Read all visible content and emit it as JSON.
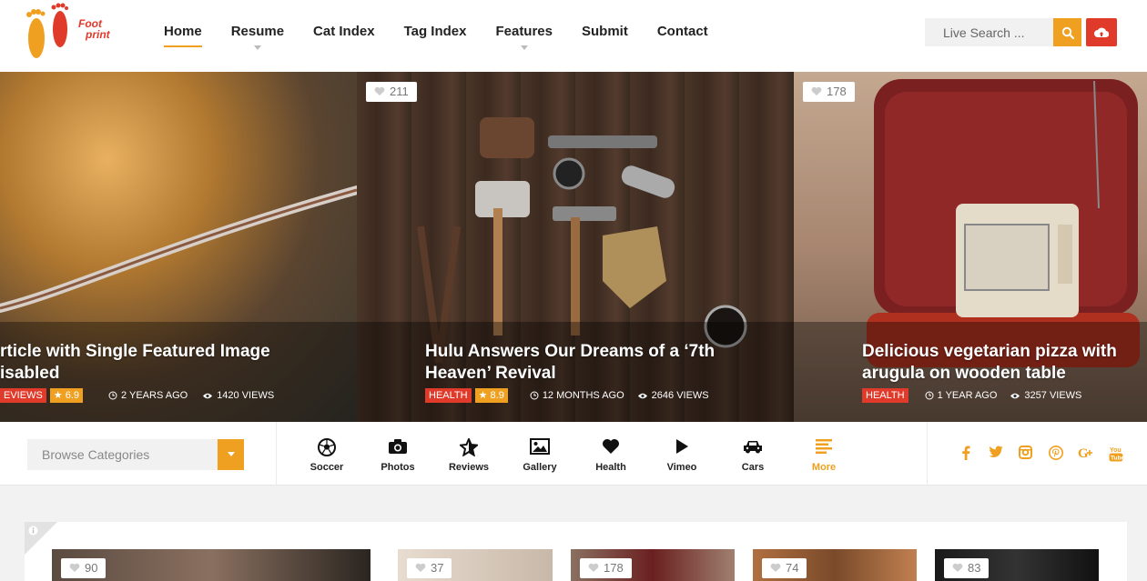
{
  "logo": {
    "text_line1": "Foot",
    "text_line2": "print"
  },
  "nav": {
    "items": [
      {
        "label": "Home",
        "active": true,
        "has_dropdown": false
      },
      {
        "label": "Resume",
        "active": false,
        "has_dropdown": true
      },
      {
        "label": "Cat Index",
        "active": false,
        "has_dropdown": false
      },
      {
        "label": "Tag Index",
        "active": false,
        "has_dropdown": false
      },
      {
        "label": "Features",
        "active": false,
        "has_dropdown": true
      },
      {
        "label": "Submit",
        "active": false,
        "has_dropdown": false
      },
      {
        "label": "Contact",
        "active": false,
        "has_dropdown": false
      }
    ]
  },
  "search": {
    "placeholder": "Live Search ..."
  },
  "slides": [
    {
      "title_line1": "rticle with Single Featured Image",
      "title_line2": "isabled",
      "category": "EVIEWS",
      "rating": "6.9",
      "age": "2 YEARS AGO",
      "views": "1420 VIEWS",
      "likes": ""
    },
    {
      "title_line1": "Hulu Answers Our Dreams of a ‘7th",
      "title_line2": "Heaven’ Revival",
      "category": "HEALTH",
      "rating": "8.9",
      "age": "12 MONTHS AGO",
      "views": "2646 VIEWS",
      "likes": "211"
    },
    {
      "title_line1": "Delicious vegetarian pizza with",
      "title_line2": "arugula on wooden table",
      "category": "HEALTH",
      "rating": "",
      "age": "1 YEAR AGO",
      "views": "3257 VIEWS",
      "likes": "178"
    }
  ],
  "categories": {
    "browse_label": "Browse Categories",
    "items": [
      {
        "label": "Soccer",
        "icon": "soccer-ball-icon"
      },
      {
        "label": "Photos",
        "icon": "camera-icon"
      },
      {
        "label": "Reviews",
        "icon": "star-icon"
      },
      {
        "label": "Gallery",
        "icon": "image-icon"
      },
      {
        "label": "Health",
        "icon": "heart-icon"
      },
      {
        "label": "Vimeo",
        "icon": "play-icon"
      },
      {
        "label": "Cars",
        "icon": "car-icon"
      },
      {
        "label": "More",
        "icon": "menu-lines-icon"
      }
    ]
  },
  "social": [
    "facebook-icon",
    "twitter-icon",
    "instagram-icon",
    "pinterest-icon",
    "google-plus-icon",
    "youtube-icon"
  ],
  "cards": [
    {
      "likes": "90"
    },
    {
      "likes": "37"
    },
    {
      "likes": "178"
    },
    {
      "likes": "74"
    },
    {
      "likes": "83"
    }
  ],
  "colors": {
    "accent": "#f0a020",
    "red": "#e03a2b"
  }
}
